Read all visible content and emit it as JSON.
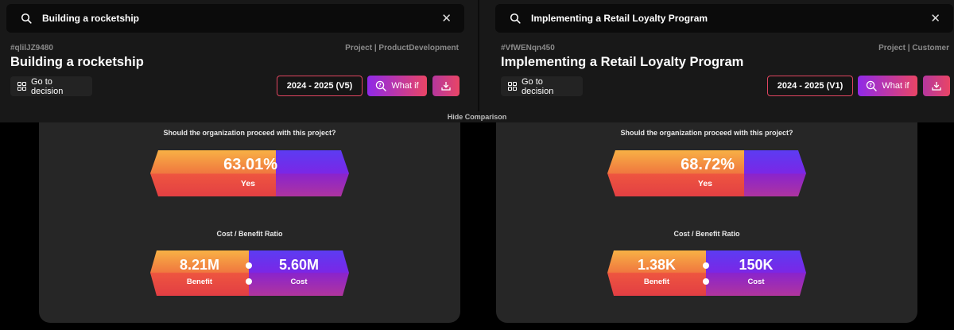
{
  "hide_comparison_label": "Hide Comparison",
  "panels": [
    {
      "search_text": "Building a rocketship",
      "id": "#qlilJZ9480",
      "category": "Project | ProductDevelopment",
      "title": "Building a rocketship",
      "goto_label": "Go to decision",
      "version_label": "2024 - 2025 (V5)",
      "whatif_label": "What if",
      "question": "Should the organization proceed with this project?",
      "yes_percent": "63.01%",
      "yes_fraction": 0.6301,
      "yes_label": "Yes",
      "ratio_label": "Cost / Benefit Ratio",
      "benefit_value": "8.21M",
      "benefit_label": "Benefit",
      "cost_value": "5.60M",
      "cost_label": "Cost"
    },
    {
      "search_text": "Implementing a Retail Loyalty Program",
      "id": "#VfWENqn450",
      "category": "Project | Customer",
      "title": "Implementing a Retail Loyalty Program",
      "goto_label": "Go to decision",
      "version_label": "2024 - 2025 (V1)",
      "whatif_label": "What if",
      "question": "Should the organization proceed with this project?",
      "yes_percent": "68.72%",
      "yes_fraction": 0.6872,
      "yes_label": "Yes",
      "ratio_label": "Cost / Benefit Ratio",
      "benefit_value": "1.38K",
      "benefit_label": "Benefit",
      "cost_value": "150K",
      "cost_label": "Cost"
    }
  ],
  "colors": {
    "accent_pink": "#e94565",
    "accent_purple": "#8f29e8",
    "yes_top": "#f6a740",
    "yes_bottom": "#e94a3c",
    "no_top": "#7a1fe8",
    "no_bottom": "#b0359d"
  },
  "icons": {
    "search": "search-icon",
    "close": "close-icon",
    "grid": "grid-icon",
    "whatif": "question-search-icon",
    "download": "download-icon"
  }
}
